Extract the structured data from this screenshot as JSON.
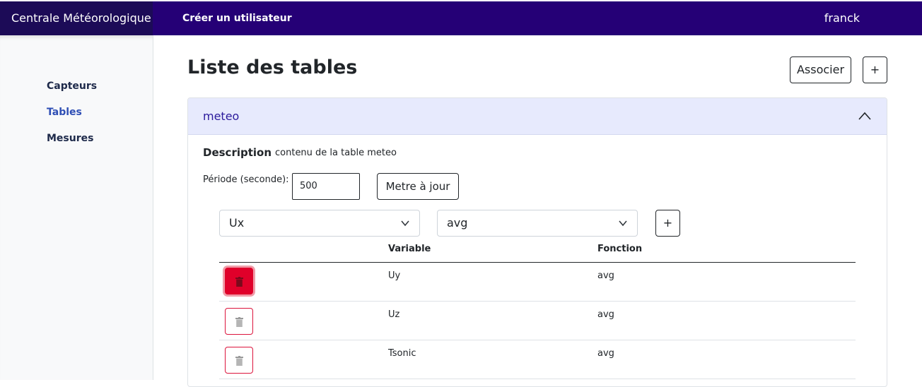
{
  "navbar": {
    "brand": "Centrale Météorologique",
    "create_user": "Créer un utilisateur",
    "username": "franck",
    "colors": {
      "bar": "#250076",
      "brand_bg": "#1c0b57"
    }
  },
  "sidebar": {
    "items": [
      {
        "label": "Capteurs"
      },
      {
        "label": "Tables",
        "active": true
      },
      {
        "label": "Mesures"
      }
    ]
  },
  "main": {
    "title": "Liste des tables",
    "associate_label": "Associer",
    "add_label": "+"
  },
  "table_card": {
    "name": "meteo",
    "expanded_icon": "chevron-up-icon",
    "description_label": "Description",
    "description_value": "contenu de la table meteo",
    "period_label": "Période (seconde):",
    "period_value": "500",
    "update_label": "Metre à jour",
    "variable_select": "Ux",
    "function_select": "avg",
    "add_row_label": "+",
    "columns": [
      "",
      "Variable",
      "Fonction"
    ],
    "rows": [
      {
        "variable": "Uy",
        "function": "avg",
        "delete_icon": "trash-icon"
      },
      {
        "variable": "Uz",
        "function": "avg",
        "delete_icon": "trash-icon"
      },
      {
        "variable": "Tsonic",
        "function": "avg",
        "delete_icon": "trash-icon"
      }
    ],
    "colors": {
      "header_bg": "#e7eafd",
      "title": "#2b1a9c",
      "danger": "#dc143c"
    }
  }
}
